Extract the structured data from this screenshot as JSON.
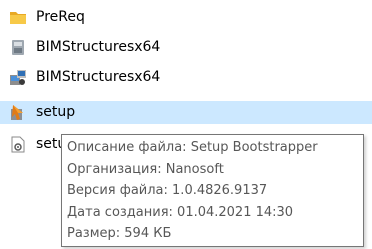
{
  "files": [
    {
      "name": "PreReq",
      "icon": "folder-icon"
    },
    {
      "name": "BIMStructuresx64",
      "icon": "disk-package-icon"
    },
    {
      "name": "BIMStructuresx64",
      "icon": "installer-package-icon"
    },
    {
      "name": "setup",
      "icon": "setup-exe-icon",
      "selected": true
    },
    {
      "name": "setup",
      "icon": "config-file-icon"
    }
  ],
  "tooltip": {
    "description": "Описание файла: Setup Bootstrapper",
    "company": "Организация: Nanosoft",
    "version": "Версия файла: 1.0.4826.9137",
    "created": "Дата создания: 01.04.2021 14:30",
    "size": "Размер: 594 КБ"
  },
  "colors": {
    "selection": "#cce8ff",
    "folder": "#f4c542",
    "tooltip_border": "#767676",
    "tooltip_text": "#575757"
  }
}
